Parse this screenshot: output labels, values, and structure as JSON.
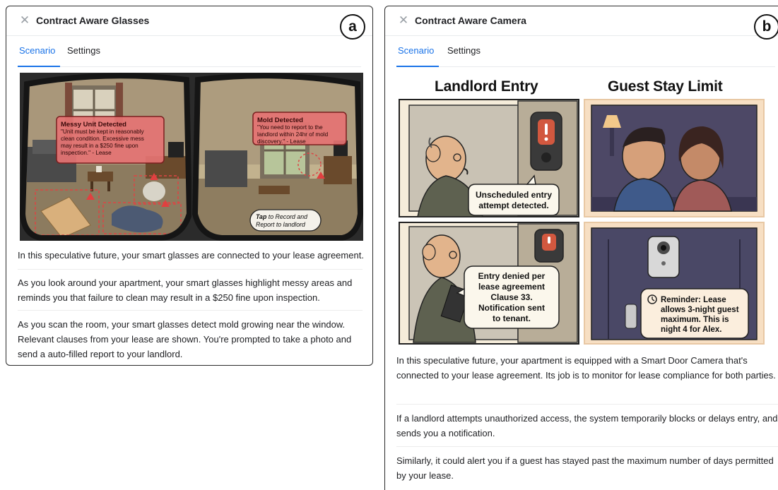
{
  "panel_a": {
    "badge": "a",
    "title": "Contract Aware Glasses",
    "tabs": [
      {
        "label": "Scenario",
        "active": true
      },
      {
        "label": "Settings",
        "active": false
      }
    ],
    "illustration": {
      "callout_left": {
        "heading": "Messy Unit Detected",
        "body_lines": [
          "\"Unit must be kept in reasonably",
          "clean condition. Excessive mess",
          "may result in a $250 fine upon",
          "inspection.\" - Lease"
        ]
      },
      "callout_right": {
        "heading": "Mold Detected",
        "body_lines": [
          "\"You need to report to the",
          "landlord within 24hr of mold",
          "discovery.\" - Lease"
        ]
      },
      "tap_button": {
        "bold": "Tap",
        "rest_line1": " to Record and",
        "line2": "Report to landlord"
      }
    },
    "paragraphs": [
      "In this speculative future, your smart glasses are connected to your lease agreement.",
      "As you look around your apartment, your smart glasses highlight messy areas and reminds you that failure to clean may result in a $250 fine upon inspection.",
      "As you scan the room, your smart glasses detect mold growing near the window. Relevant clauses from your lease are shown. You're prompted to take a photo and send a auto-filled report to your landlord."
    ]
  },
  "panel_b": {
    "badge": "b",
    "title": "Contract Aware Camera",
    "tabs": [
      {
        "label": "Scenario",
        "active": true
      },
      {
        "label": "Settings",
        "active": false
      }
    ],
    "illustration": {
      "left_title": "Landlord Entry",
      "right_title": "Guest Stay Limit",
      "bubble_entry_attempt": [
        "Unscheduled entry",
        "attempt detected."
      ],
      "bubble_entry_denied": [
        "Entry denied per",
        "lease agreement",
        "Clause 33.",
        "Notification sent",
        "to tenant."
      ],
      "bubble_reminder": [
        "Reminder: Lease",
        "allows 3-night guest",
        "maximum. This is",
        "night 4 for Alex."
      ]
    },
    "paragraphs": [
      "In this speculative future, your apartment is equipped with a Smart Door Camera that's connected to your lease agreement. Its job is to monitor for lease compliance for both parties.",
      "If a landlord attempts unauthorized access, the system temporarily blocks or delays entry, and sends you a notification.",
      "Similarly, it could alert you if a guest has stayed past the maximum number of days permitted by your lease."
    ]
  }
}
